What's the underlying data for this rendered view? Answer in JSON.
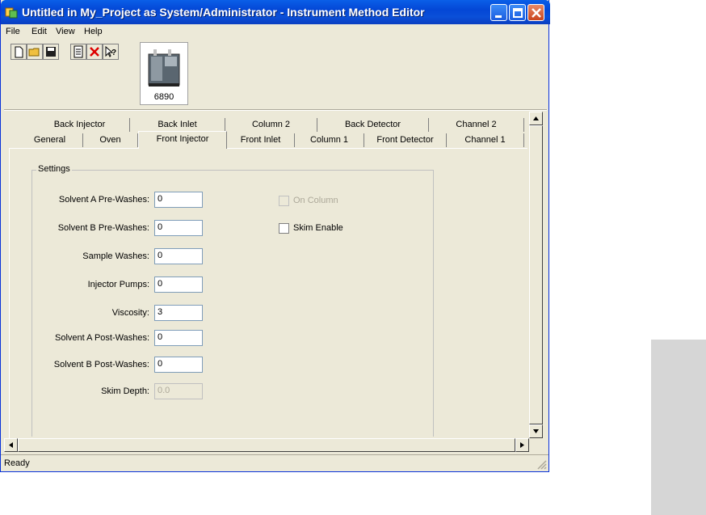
{
  "window": {
    "title": "Untitled in My_Project as System/Administrator - Instrument Method Editor",
    "controls": [
      "minimize-icon",
      "maximize-icon",
      "close-icon"
    ]
  },
  "menu": {
    "file": "File",
    "edit": "Edit",
    "view": "View",
    "help": "Help"
  },
  "toolbar": {
    "icons": [
      "new-document-icon",
      "open-folder-icon",
      "save-disk-icon",
      "report-icon",
      "delete-x-icon",
      "context-help-icon"
    ]
  },
  "device": {
    "label": "6890"
  },
  "tabs": {
    "top_row": [
      "Back Injector",
      "Back Inlet",
      "Column 2",
      "Back Detector",
      "Channel 2"
    ],
    "bottom_row": [
      "General",
      "Oven",
      "Front Injector",
      "Front Inlet",
      "Column 1",
      "Front Detector",
      "Channel 1"
    ],
    "active": "Front Injector"
  },
  "settings": {
    "group_label": "Settings",
    "fields": [
      {
        "label": "Solvent A Pre-Washes:",
        "value": "0"
      },
      {
        "label": "Solvent B Pre-Washes:",
        "value": "0"
      },
      {
        "label": "Sample Washes:",
        "value": "0"
      },
      {
        "label": "Injector Pumps:",
        "value": "0"
      },
      {
        "label": "Viscosity:",
        "value": "3"
      },
      {
        "label": "Solvent A Post-Washes:",
        "value": "0"
      },
      {
        "label": "Solvent B Post-Washes:",
        "value": "0"
      },
      {
        "label": "Skim Depth:",
        "value": "0.0",
        "disabled": true
      }
    ],
    "checkboxes": [
      {
        "label": "On Column",
        "checked": false,
        "disabled": true
      },
      {
        "label": "Skim Enable",
        "checked": false,
        "disabled": false
      }
    ]
  },
  "status": {
    "text": "Ready"
  },
  "colors": {
    "titlebar": "#0a4fd8",
    "window_bg": "#ece9d8"
  }
}
